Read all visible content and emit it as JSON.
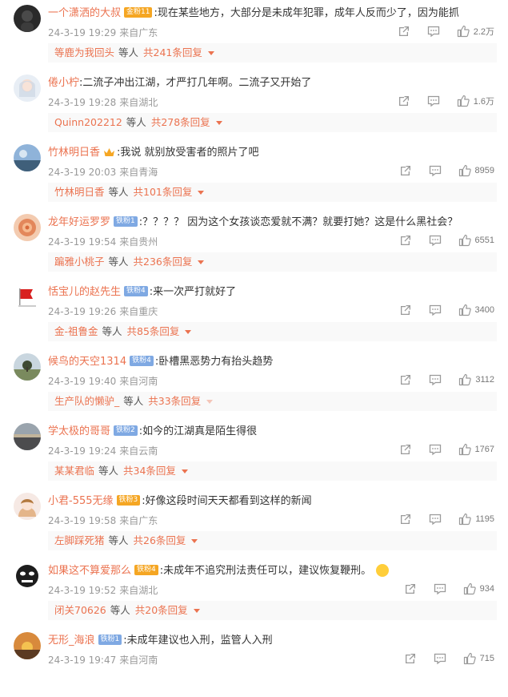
{
  "comments": [
    {
      "username": "一个潇洒的大叔",
      "badge": "金粉11",
      "badge_color": "#f5a623",
      "badge_type": "gold",
      "text": ":现在某些地方，大部分是未成年犯罪，成年人反而少了，因为能抓",
      "date": "24-3-19 19:29",
      "source": "来自广东",
      "likes": "2.2万",
      "reply_user": "等鹿为我回头",
      "reply_etc": "等人",
      "reply_count": "共241条回复",
      "avatar": "dark-face"
    },
    {
      "username": "倦小柠",
      "badge": "",
      "badge_type": "none",
      "text": ":二流子冲出江湖，才严打几年啊。二流子又开始了",
      "date": "24-3-19 19:28",
      "source": "来自湖北",
      "likes": "1.6万",
      "reply_user": "Quinn202212",
      "reply_etc": "等人",
      "reply_count": "共278条回复",
      "avatar": "girl-light"
    },
    {
      "username": "竹林明日香",
      "badge": "",
      "badge_type": "crown",
      "text": ":我说 就别放受害者的照片了吧",
      "date": "24-3-19 20:03",
      "source": "来自青海",
      "likes": "8959",
      "reply_user": "竹林明日香",
      "reply_etc": "等人",
      "reply_count": "共101条回复",
      "avatar": "sky-scene"
    },
    {
      "username": "龙年好运罗罗",
      "badge": "铁粉1",
      "badge_color": "#7fa9e3",
      "badge_type": "blue",
      "text": ":？？？？ 因为这个女孩谈恋爱就不满？就要打她？这是什么黑社会？",
      "date": "24-3-19 19:54",
      "source": "来自贵州",
      "likes": "6551",
      "reply_user": "蹁雅小桃子",
      "reply_etc": "等人",
      "reply_count": "共236条回复",
      "avatar": "orange-swirl"
    },
    {
      "username": "恬宝儿的赵先生",
      "badge": "铁粉4",
      "badge_color": "#7fa9e3",
      "badge_type": "blue",
      "text": ":来一次严打就好了",
      "date": "24-3-19 19:26",
      "source": "来自重庆",
      "likes": "3400",
      "reply_user": "金-祖鲁金",
      "reply_etc": "等人",
      "reply_count": "共85条回复",
      "avatar": "red-flag"
    },
    {
      "username": "候鸟的天空1314",
      "badge": "铁粉4",
      "badge_color": "#7fa9e3",
      "badge_type": "blue",
      "text": ":卧槽黑恶势力有抬头趋势",
      "date": "24-3-19 19:40",
      "source": "来自河南",
      "likes": "3112",
      "reply_user": "生产队的懒驴_",
      "reply_etc": "等人",
      "reply_count": "共33条回复",
      "avatar": "field-tree"
    },
    {
      "username": "学太极的哥哥",
      "badge": "铁粉2",
      "badge_color": "#7fa9e3",
      "badge_type": "blue",
      "text": ":如今的江湖真是陌生得很",
      "date": "24-3-19 19:24",
      "source": "来自云南",
      "likes": "1767",
      "reply_user": "某某君临",
      "reply_etc": "等人",
      "reply_count": "共34条回复",
      "avatar": "dusk-hill"
    },
    {
      "username": "小君-555无缘",
      "badge": "铁粉3",
      "badge_color": "#f5a623",
      "badge_type": "gold",
      "text": ":好像这段时间天天都看到这样的新闻",
      "date": "24-3-19 19:58",
      "source": "来自广东",
      "likes": "1195",
      "reply_user": "左脚踩死猪",
      "reply_etc": "等人",
      "reply_count": "共26条回复",
      "avatar": "girl-pink"
    },
    {
      "username": "如果这不算爱那么",
      "badge": "铁粉4",
      "badge_color": "#f5a623",
      "badge_type": "gold",
      "text": ":未成年不追究刑法责任可以，建议恢复鞭刑。",
      "date": "24-3-19 19:52",
      "source": "来自湖北",
      "likes": "934",
      "reply_user": "闭关70626",
      "reply_etc": "等人",
      "reply_count": "共20条回复",
      "avatar": "meme-face",
      "emoji": true
    },
    {
      "username": "无形_海浪",
      "badge": "铁粉1",
      "badge_color": "#7fa9e3",
      "badge_type": "blue",
      "text": ":未成年建议也入刑，监管人入刑",
      "date": "24-3-19 19:47",
      "source": "来自河南",
      "likes": "715",
      "reply_user": "",
      "reply_etc": "",
      "reply_count": "",
      "avatar": "sunset"
    }
  ],
  "colors": {
    "accent": "#eb7350",
    "meta": "#999999",
    "reply_bg": "#f9f9f9"
  },
  "icons": {
    "share": "share-icon",
    "comment": "comment-icon",
    "like": "thumbs-up-icon"
  }
}
